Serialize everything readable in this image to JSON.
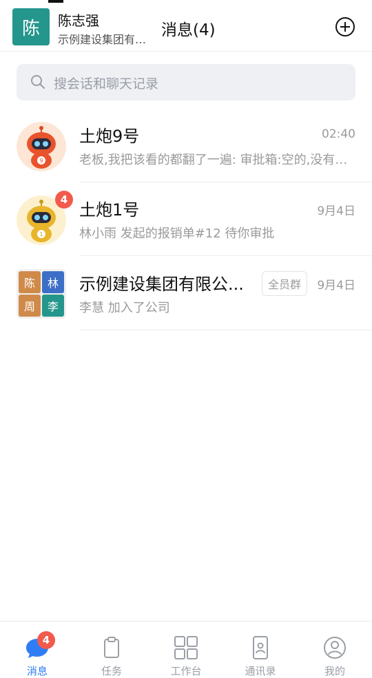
{
  "header": {
    "org_avatar_char": "陈",
    "user_name": "陈志强",
    "org_name": "示例建设集团有限公司",
    "title": "消息(4)"
  },
  "search": {
    "placeholder": "搜会话和聊天记录"
  },
  "conversations": [
    {
      "name": "土炮9号",
      "time": "02:40",
      "preview": "老板,我把该看的都翻了一遍: 审批箱:空的,没有待审批",
      "avatar_color": "#e8532b",
      "avatar_number": "9"
    },
    {
      "name": "土炮1号",
      "time": "9月4日",
      "preview": "林小雨 发起的报销单#12 待你审批",
      "badge": "4",
      "avatar_color": "#e8b52b",
      "avatar_number": "1"
    },
    {
      "name": "示例建设集团有限公...",
      "tag": "全员群",
      "time": "9月4日",
      "preview": "李慧 加入了公司",
      "members": [
        "陈",
        "林",
        "周",
        "李"
      ],
      "member_colors": [
        "#cf8a4a",
        "#3d6fc7",
        "#cf8a4a",
        "#24968c"
      ]
    }
  ],
  "tabs": [
    {
      "label": "消息",
      "icon": "chat-bubble-icon",
      "active": true,
      "badge": "4"
    },
    {
      "label": "任务",
      "icon": "clipboard-icon"
    },
    {
      "label": "工作台",
      "icon": "grid-icon"
    },
    {
      "label": "通讯录",
      "icon": "phone-contacts-icon"
    },
    {
      "label": "我的",
      "icon": "user-profile-icon"
    }
  ],
  "colors": {
    "accent": "#2e7df5",
    "badge": "#f25a4c",
    "org_avatar": "#24968c"
  }
}
